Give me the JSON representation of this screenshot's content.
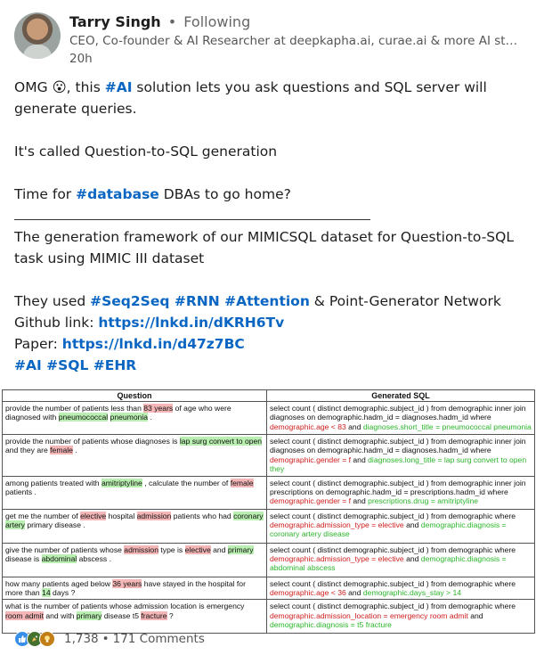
{
  "author": {
    "name": "Tarry Singh",
    "separator": "•",
    "follow_status": "Following",
    "headline": "CEO, Co-founder & AI Researcher at deepkapha.ai, curae.ai & more AI st…",
    "time": "20h"
  },
  "post": {
    "line1_a": "OMG 😮, this ",
    "line1_tag": "#AI",
    "line1_b": " solution lets you ask questions and SQL server will generate queries.",
    "line2": "It's called Question-to-SQL generation",
    "line3_a": "Time for ",
    "line3_tag": "#database",
    "line3_b": " DBAs to go home?",
    "line4": "The generation framework of our MIMICSQL dataset for Question-to-SQL task using MIMIC III dataset",
    "line5_a": "They used ",
    "line5_tags": "#Seq2Seq #RNN #Attention",
    "line5_b": " & Point-Generator Network",
    "github_label": "Github link: ",
    "github_url": "https://lnkd.in/dKRH6Tv",
    "paper_label": "Paper: ",
    "paper_url": "https://lnkd.in/d47z7BC",
    "tags_end": "#AI #SQL #EHR"
  },
  "table": {
    "headers": [
      "Question",
      "Generated SQL"
    ],
    "rows": [
      {
        "q": [
          "provide the number of patients less than ",
          "83 years",
          " of age who were diagnosed with ",
          "pneumococcal",
          " ",
          "pneumonia",
          " ."
        ],
        "s": [
          "select count ( distinct demographic.subject_id ) from demographic inner join diagnoses on demographic.hadm_id = diagnoses.hadm_id where ",
          "demographic.age < 83",
          " and ",
          "diagnoses.short_title = pneumococcal pneumonia"
        ]
      },
      {
        "q": [
          "provide the number of patients whose diagnoses is ",
          "lap surg convert to open",
          " and they are ",
          "female",
          " ."
        ],
        "s": [
          "select count ( distinct demographic.subject_id ) from demographic inner join diagnoses on demographic.hadm_id = diagnoses.hadm_id where ",
          "demographic.gender = f",
          " and ",
          "diagnoses.long_title = lap surg convert to open they"
        ]
      },
      {
        "q": [
          "among patients treated with ",
          "amitriptyline",
          " , calculate the number of ",
          "female",
          " patients ."
        ],
        "s": [
          "select count ( distinct demographic.subject_id ) from demographic inner join prescriptions on demographic.hadm_id = prescriptions.hadm_id where ",
          "demographic.gender = f",
          " and ",
          "prescriptions.drug = amitriptyline"
        ]
      },
      {
        "q": [
          "get me the number of ",
          "elective",
          " hospital ",
          "admission",
          " patients who had ",
          "coronary artery",
          " primary disease ."
        ],
        "s": [
          "select count ( distinct demographic.subject_id ) from demographic where ",
          "demographic.admission_type = elective",
          " and ",
          "demographic.diagnosis = coronary artery disease"
        ]
      },
      {
        "q": [
          "give the number of patients whose ",
          "admission",
          " type is ",
          "elective",
          " and ",
          "primary",
          " disease is ",
          "abdominal",
          " abscess ."
        ],
        "s": [
          "select count ( distinct demographic.subject_id ) from demographic where ",
          "demographic.admission_type = elective",
          " and ",
          "demographic.diagnosis = abdominal abscess"
        ]
      },
      {
        "q": [
          "how many patients aged below ",
          "36 years",
          " have stayed in the hospital for more than ",
          "14",
          " days ?"
        ],
        "s": [
          "select count ( distinct demographic.subject_id ) from demographic where ",
          "demographic.age < 36",
          " and ",
          "demographic.days_stay > 14"
        ]
      },
      {
        "q": [
          "what is the number of patients whose admission location is emergency ",
          "room admit",
          " and with ",
          "primary",
          " disease t5 ",
          "fracture",
          " ?"
        ],
        "s": [
          "select count ( distinct demographic.subject_id ) from demographic where ",
          "demographic.admission_location = emergency room admit",
          " and ",
          "demographic.diagnosis = t5 fracture"
        ]
      }
    ]
  },
  "footer": {
    "reactions": [
      "like-icon",
      "celebrate-icon",
      "insightful-icon"
    ],
    "count": "1,738",
    "separator": "•",
    "comments": "171 Comments"
  },
  "colors": {
    "link": "#0a66c2",
    "red_highlight": "#f4b6b6",
    "green_highlight": "#b9efb0",
    "red_text": "#d01c1c",
    "green_text": "#2ab52a"
  }
}
